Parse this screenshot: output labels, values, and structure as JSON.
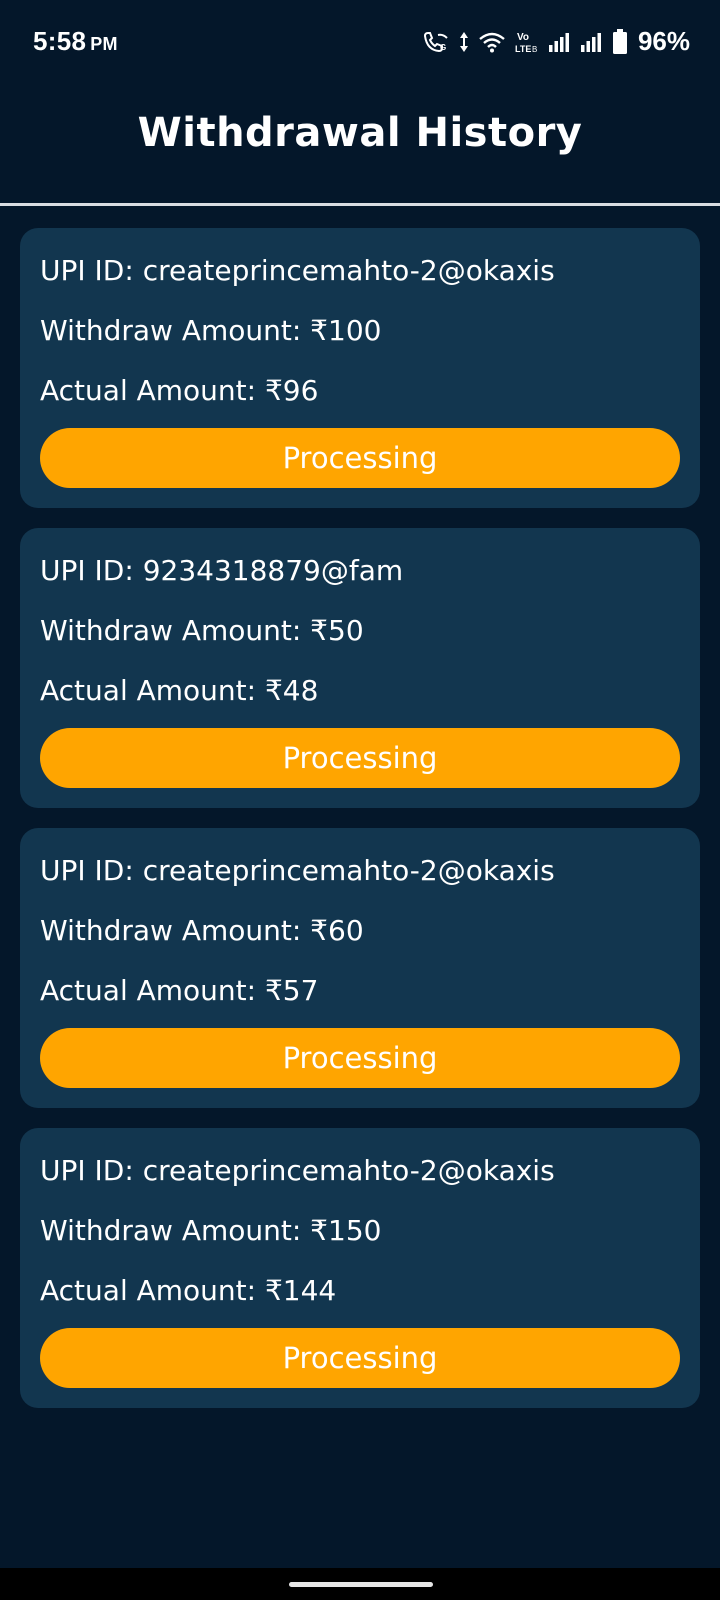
{
  "status_bar": {
    "time": "5:58",
    "ampm": "PM",
    "battery_percent": "96%",
    "icons": [
      "wifi-calling-icon",
      "data-arrows-icon",
      "wifi-icon",
      "volte-icon",
      "signal-icon",
      "signal-icon",
      "battery-icon"
    ]
  },
  "header": {
    "title": "Withdrawal History"
  },
  "withdrawals": [
    {
      "upi_label": "UPI ID: createprincemahto-2@okaxis",
      "withdraw_label": "Withdraw Amount: ₹100",
      "actual_label": "Actual Amount: ₹96",
      "status": "Processing"
    },
    {
      "upi_label": "UPI ID: 9234318879@fam",
      "withdraw_label": "Withdraw Amount: ₹50",
      "actual_label": "Actual Amount: ₹48",
      "status": "Processing"
    },
    {
      "upi_label": "UPI ID: createprincemahto-2@okaxis",
      "withdraw_label": "Withdraw Amount: ₹60",
      "actual_label": "Actual Amount: ₹57",
      "status": "Processing"
    },
    {
      "upi_label": "UPI ID: createprincemahto-2@okaxis",
      "withdraw_label": "Withdraw Amount: ₹150",
      "actual_label": "Actual Amount: ₹144",
      "status": "Processing"
    }
  ],
  "colors": {
    "background": "#04172a",
    "card": "#12364f",
    "status_button": "#ffa500",
    "text": "#ffffff"
  }
}
